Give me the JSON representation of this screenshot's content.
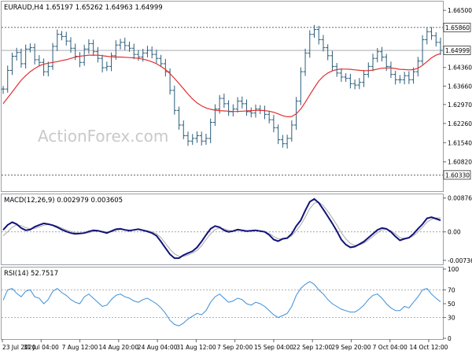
{
  "chart_data": [
    {
      "type": "line",
      "panel": "price",
      "title": "EURAUD,H4 1.65197 1.65262 1.64963 1.64999",
      "watermark": "ActionForex.com",
      "ylim": [
        1.5975,
        1.668
      ],
      "y_ticks": [
        "1.66500",
        "1.64360",
        "1.63660",
        "1.62970",
        "1.62260",
        "1.61540",
        "1.60820"
      ],
      "hlines": [
        {
          "label": "1.65860",
          "value": 1.6586,
          "style": "dotted"
        },
        {
          "label": "1.60330",
          "value": 1.6033,
          "style": "dotted"
        }
      ],
      "current_price": {
        "label": "1.64999",
        "value": 1.64999
      },
      "series": [
        {
          "style": "bars",
          "color": "#2b5d7a",
          "values": [
            1.6355,
            1.6425,
            1.6478,
            1.6492,
            1.645,
            1.6505,
            1.651,
            1.6465,
            1.6455,
            1.642,
            1.644,
            1.6515,
            1.656,
            1.6552,
            1.6535,
            1.6508,
            1.6478,
            1.6455,
            1.6505,
            1.6525,
            1.6495,
            1.647,
            1.6435,
            1.644,
            1.648,
            1.652,
            1.653,
            1.6518,
            1.6508,
            1.6485,
            1.6475,
            1.649,
            1.65,
            1.6485,
            1.647,
            1.645,
            1.642,
            1.635,
            1.6275,
            1.622,
            1.618,
            1.616,
            1.617,
            1.618,
            1.616,
            1.617,
            1.623,
            1.628,
            1.632,
            1.63,
            1.627,
            1.628,
            1.631,
            1.63,
            1.627,
            1.6265,
            1.628,
            1.6275,
            1.626,
            1.624,
            1.621,
            1.6165,
            1.615,
            1.617,
            1.622,
            1.631,
            1.642,
            1.649,
            1.656,
            1.6578,
            1.654,
            1.651,
            1.648,
            1.644,
            1.6415,
            1.64,
            1.6395,
            1.6375,
            1.637,
            1.638,
            1.641,
            1.644,
            1.647,
            1.6495,
            1.6475,
            1.644,
            1.641,
            1.639,
            1.639,
            1.6405,
            1.639,
            1.642,
            1.646,
            1.654,
            1.657,
            1.6555,
            1.653,
            1.65
          ]
        },
        {
          "style": "line",
          "color": "#e03030",
          "values": [
            1.63,
            1.6322,
            1.6344,
            1.6366,
            1.6388,
            1.6405,
            1.642,
            1.6432,
            1.6442,
            1.6448,
            1.6452,
            1.6455,
            1.6458,
            1.6462,
            1.6465,
            1.647,
            1.6475,
            1.6478,
            1.648,
            1.6482,
            1.6482,
            1.6482,
            1.648,
            1.6478,
            1.6476,
            1.6475,
            1.6475,
            1.6474,
            1.6473,
            1.6472,
            1.647,
            1.6467,
            1.6463,
            1.6457,
            1.645,
            1.644,
            1.6428,
            1.6413,
            1.6395,
            1.6376,
            1.6356,
            1.6336,
            1.6318,
            1.6303,
            1.6292,
            1.6284,
            1.6279,
            1.6276,
            1.6274,
            1.6273,
            1.6272,
            1.6271,
            1.6271,
            1.6272,
            1.6273,
            1.6274,
            1.6275,
            1.6275,
            1.6274,
            1.6272,
            1.6268,
            1.6262,
            1.6255,
            1.6251,
            1.6252,
            1.6262,
            1.628,
            1.6305,
            1.6333,
            1.636,
            1.6385,
            1.6403,
            1.6415,
            1.6423,
            1.6428,
            1.643,
            1.643,
            1.6429,
            1.6427,
            1.6425,
            1.6424,
            1.6424,
            1.6426,
            1.643,
            1.6433,
            1.6434,
            1.6434,
            1.6432,
            1.6429,
            1.6428,
            1.6427,
            1.6428,
            1.6433,
            1.6444,
            1.6458,
            1.6472,
            1.6482,
            1.6488
          ]
        }
      ]
    },
    {
      "type": "line",
      "panel": "macd",
      "title": "MACD(12,26,9) 0.002979 0.003605",
      "ylim": [
        -0.0082,
        0.0093
      ],
      "y_ticks": [
        "0.008761",
        "0.00",
        "-0.007367"
      ],
      "zero_line": 0,
      "series": [
        {
          "style": "line",
          "color": "#12127a",
          "values": [
            0.0005,
            0.0018,
            0.0025,
            0.002,
            0.001,
            0.0004,
            0.0006,
            0.0013,
            0.0018,
            0.0022,
            0.002,
            0.0017,
            0.0012,
            0.0006,
            0.0001,
            -0.0003,
            -0.0005,
            -0.0004,
            -0.0003,
            0.0001,
            0.0004,
            0.0003,
            0.0,
            -0.0003,
            0.0002,
            0.0007,
            0.0008,
            0.0005,
            0.0003,
            0.0005,
            0.0007,
            0.0004,
            0.0001,
            -0.0003,
            -0.001,
            -0.0025,
            -0.0042,
            -0.0058,
            -0.0068,
            -0.0068,
            -0.006,
            -0.0055,
            -0.005,
            -0.004,
            -0.0025,
            -0.0008,
            0.0008,
            0.0015,
            0.0012,
            0.0004,
            0.0,
            0.0002,
            0.0006,
            0.0004,
            0.0002,
            0.0003,
            0.0004,
            0.0002,
            0.0,
            -0.0008,
            -0.002,
            -0.0024,
            -0.0018,
            -0.0016,
            -0.0005,
            0.0015,
            0.003,
            0.0055,
            0.0078,
            0.0085,
            0.0075,
            0.0058,
            0.004,
            0.0022,
            0.0002,
            -0.002,
            -0.0033,
            -0.004,
            -0.0038,
            -0.0032,
            -0.0025,
            -0.0015,
            -0.0005,
            0.0005,
            0.001,
            0.0008,
            0.0,
            -0.0012,
            -0.0022,
            -0.0018,
            -0.0015,
            -0.0005,
            0.0008,
            0.002,
            0.0035,
            0.0038,
            0.0034,
            0.003
          ]
        },
        {
          "style": "line",
          "color": "#a8a8a8",
          "values": [
            -0.001,
            0.0,
            0.0012,
            0.0018,
            0.0016,
            0.0011,
            0.0008,
            0.0009,
            0.0013,
            0.0017,
            0.0019,
            0.0018,
            0.0015,
            0.001,
            0.0005,
            0.0001,
            -0.0002,
            -0.0003,
            -0.0003,
            -0.0002,
            0.0001,
            0.0002,
            0.0002,
            0.0,
            0.0,
            0.0003,
            0.0006,
            0.0006,
            0.0005,
            0.0005,
            0.0006,
            0.0005,
            0.0003,
            0.0,
            -0.0005,
            -0.0015,
            -0.003,
            -0.0045,
            -0.0057,
            -0.0063,
            -0.0063,
            -0.006,
            -0.0055,
            -0.0048,
            -0.0036,
            -0.002,
            -0.0005,
            0.0006,
            0.001,
            0.0008,
            0.0004,
            0.0002,
            0.0004,
            0.0004,
            0.0003,
            0.0003,
            0.0004,
            0.0003,
            0.0001,
            -0.0004,
            -0.0012,
            -0.0018,
            -0.0019,
            -0.0017,
            -0.001,
            0.0003,
            0.0018,
            0.0038,
            0.006,
            0.0074,
            0.0077,
            0.0068,
            0.0053,
            0.0036,
            0.0018,
            -0.0002,
            -0.0018,
            -0.003,
            -0.0035,
            -0.0034,
            -0.0029,
            -0.0021,
            -0.0012,
            -0.0002,
            0.0005,
            0.0007,
            0.0003,
            -0.0005,
            -0.0015,
            -0.0017,
            -0.0016,
            -0.001,
            0.0,
            0.0012,
            0.0025,
            0.0033,
            0.0036,
            0.0036
          ]
        }
      ]
    },
    {
      "type": "line",
      "panel": "rsi",
      "title": "RSI(14) 52.7517",
      "ylim": [
        0,
        100
      ],
      "y_ticks": [
        "100",
        "70",
        "50",
        "30",
        "0"
      ],
      "hlines": [
        {
          "value": 70,
          "style": "dotted"
        },
        {
          "value": 30,
          "style": "dotted"
        }
      ],
      "categories": [
        "23 Jul 2020",
        "31 Jul 04:00",
        "7 Aug 12:00",
        "14 Aug 20:00",
        "24 Aug 04:00",
        "31 Aug 12:00",
        "7 Sep 20:00",
        "15 Sep 04:00",
        "22 Sep 12:00",
        "29 Sep 20:00",
        "7 Oct 04:00",
        "14 Oct 12:00"
      ],
      "series": [
        {
          "style": "line",
          "color": "#3b8fd8",
          "values": [
            55,
            70,
            72,
            65,
            60,
            68,
            70,
            60,
            58,
            50,
            56,
            68,
            72,
            66,
            62,
            56,
            52,
            50,
            60,
            64,
            58,
            52,
            46,
            48,
            56,
            62,
            64,
            60,
            58,
            54,
            52,
            56,
            58,
            54,
            50,
            44,
            36,
            26,
            20,
            18,
            22,
            28,
            32,
            36,
            34,
            40,
            52,
            60,
            64,
            58,
            52,
            54,
            58,
            56,
            50,
            48,
            52,
            50,
            46,
            40,
            34,
            30,
            33,
            36,
            46,
            62,
            72,
            78,
            82,
            78,
            70,
            64,
            56,
            50,
            46,
            42,
            40,
            38,
            38,
            42,
            48,
            56,
            62,
            64,
            58,
            50,
            44,
            40,
            40,
            46,
            44,
            52,
            60,
            70,
            72,
            64,
            58,
            52.75
          ]
        }
      ]
    }
  ]
}
